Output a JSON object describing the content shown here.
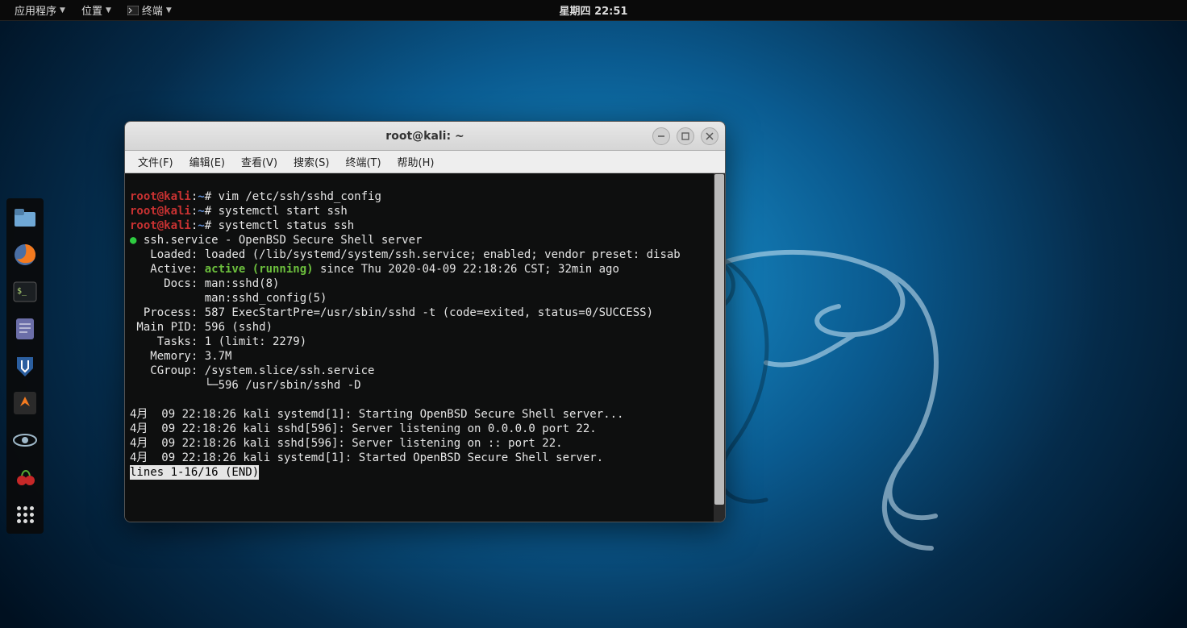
{
  "panel": {
    "apps": "应用程序",
    "places": "位置",
    "terminal": "终端",
    "clock": "星期四 22:51"
  },
  "dock": {
    "files": "files-icon",
    "firefox": "firefox-icon",
    "terminal": "terminal-icon",
    "texteditor": "texteditor-icon",
    "metasploit": "metasploit-icon",
    "burp": "burp-icon",
    "eye": "eye-icon",
    "cherry": "cherrytree-icon",
    "apps": "apps-grid-icon"
  },
  "window": {
    "title": "root@kali: ~",
    "menu": {
      "file": "文件(F)",
      "edit": "编辑(E)",
      "view": "查看(V)",
      "search": "搜索(S)",
      "terminal": "终端(T)",
      "help": "帮助(H)"
    }
  },
  "term": {
    "prompt_user": "root@kali",
    "prompt_sep": ":",
    "prompt_path": "~",
    "prompt_hash": "#",
    "cmd1": " vim /etc/ssh/sshd_config",
    "cmd2": " systemctl start ssh",
    "cmd3": " systemctl status ssh",
    "bullet": "●",
    "svc_header": " ssh.service - OpenBSD Secure Shell server",
    "loaded": "   Loaded: loaded (/lib/systemd/system/ssh.service; enabled; vendor preset: disab",
    "active_label": "   Active: ",
    "active_value": "active (running)",
    "active_rest": " since Thu 2020-04-09 22:18:26 CST; 32min ago",
    "docs1": "     Docs: man:sshd(8)",
    "docs2": "           man:sshd_config(5)",
    "process": "  Process: 587 ExecStartPre=/usr/sbin/sshd -t (code=exited, status=0/SUCCESS)",
    "mainpid": " Main PID: 596 (sshd)",
    "tasks": "    Tasks: 1 (limit: 2279)",
    "memory": "   Memory: 3.7M",
    "cgroup": "   CGroup: /system.slice/ssh.service",
    "cgroup_child": "           └─596 /usr/sbin/sshd -D",
    "blank": "",
    "log1": "4月  09 22:18:26 kali systemd[1]: Starting OpenBSD Secure Shell server...",
    "log2": "4月  09 22:18:26 kali sshd[596]: Server listening on 0.0.0.0 port 22.",
    "log3": "4月  09 22:18:26 kali sshd[596]: Server listening on :: port 22.",
    "log4": "4月  09 22:18:26 kali systemd[1]: Started OpenBSD Secure Shell server.",
    "end": "lines 1-16/16 (END)"
  }
}
